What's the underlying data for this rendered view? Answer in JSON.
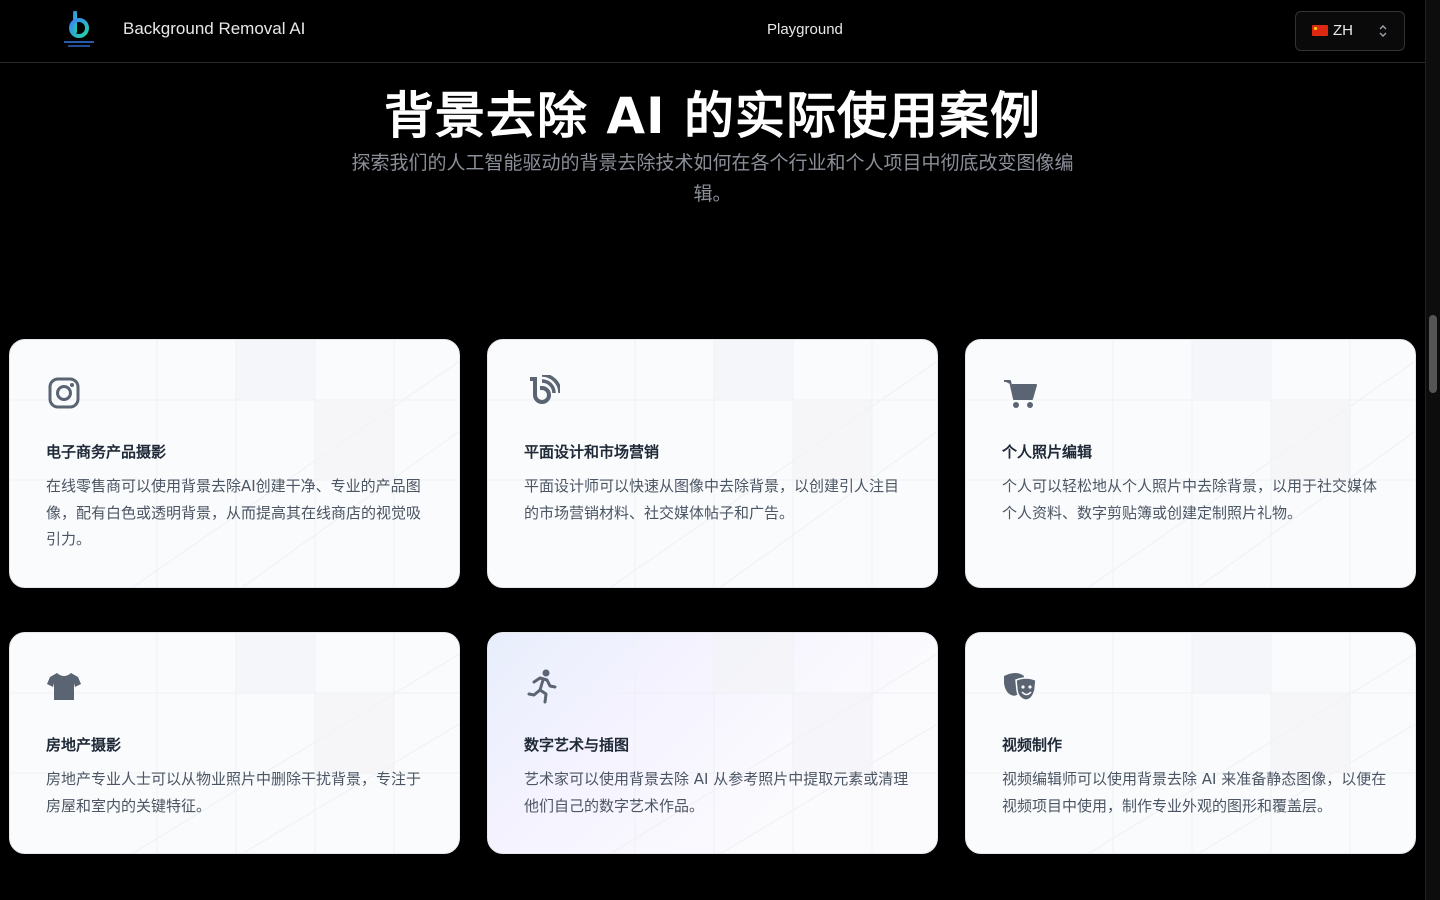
{
  "header": {
    "brand": "Background Removal AI",
    "nav_link": "Playground",
    "language": {
      "code": "ZH",
      "flag": "cn-flag-icon"
    }
  },
  "hero": {
    "title": "背景去除 AI 的实际使用案例",
    "subtitle": "探索我们的人工智能驱动的背景去除技术如何在各个行业和个人项目中彻底改变图像编辑。"
  },
  "cards": [
    {
      "icon": "instagram-icon",
      "title": "电子商务产品摄影",
      "description": "在线零售商可以使用背景去除AI创建干净、专业的产品图像，配有白色或透明背景，从而提高其在线商店的视觉吸引力。"
    },
    {
      "icon": "blogger-icon",
      "title": "平面设计和市场营销",
      "description": "平面设计师可以快速从图像中去除背景，以创建引人注目的市场营销材料、社交媒体帖子和广告。"
    },
    {
      "icon": "shopping-cart-icon",
      "title": "个人照片编辑",
      "description": "个人可以轻松地从个人照片中去除背景，以用于社交媒体个人资料、数字剪贴簿或创建定制照片礼物。"
    },
    {
      "icon": "tshirt-icon",
      "title": "房地产摄影",
      "description": "房地产专业人士可以从物业照片中删除干扰背景，专注于房屋和室内的关键特征。"
    },
    {
      "icon": "running-person-icon",
      "title": "数字艺术与插图",
      "description": "艺术家可以使用背景去除 AI 从参考照片中提取元素或清理他们自己的数字艺术作品。"
    },
    {
      "icon": "theater-masks-icon",
      "title": "视频制作",
      "description": "视频编辑师可以使用背景去除 AI 来准备静态图像，以便在视频项目中使用，制作专业外观的图形和覆盖层。"
    }
  ],
  "colors": {
    "background": "#000000",
    "card_bg": "#fafbfd",
    "icon": "#5b6473",
    "card_title": "#1f2937",
    "card_text": "#4b5563",
    "subtitle": "#8b8f98"
  }
}
